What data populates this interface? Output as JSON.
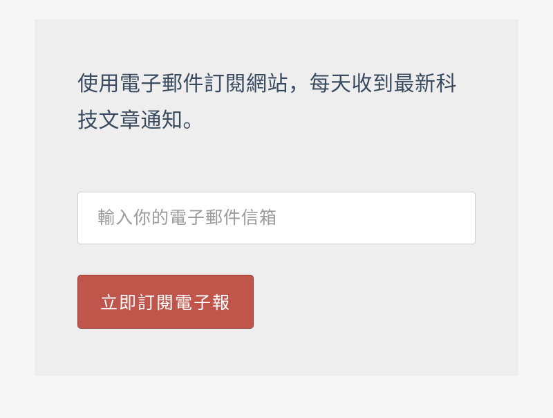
{
  "subscription": {
    "description": "使用電子郵件訂閱網站，每天收到最新科技文章通知。",
    "email_placeholder": "輸入你的電子郵件信箱",
    "button_label": "立即訂閱電子報"
  }
}
